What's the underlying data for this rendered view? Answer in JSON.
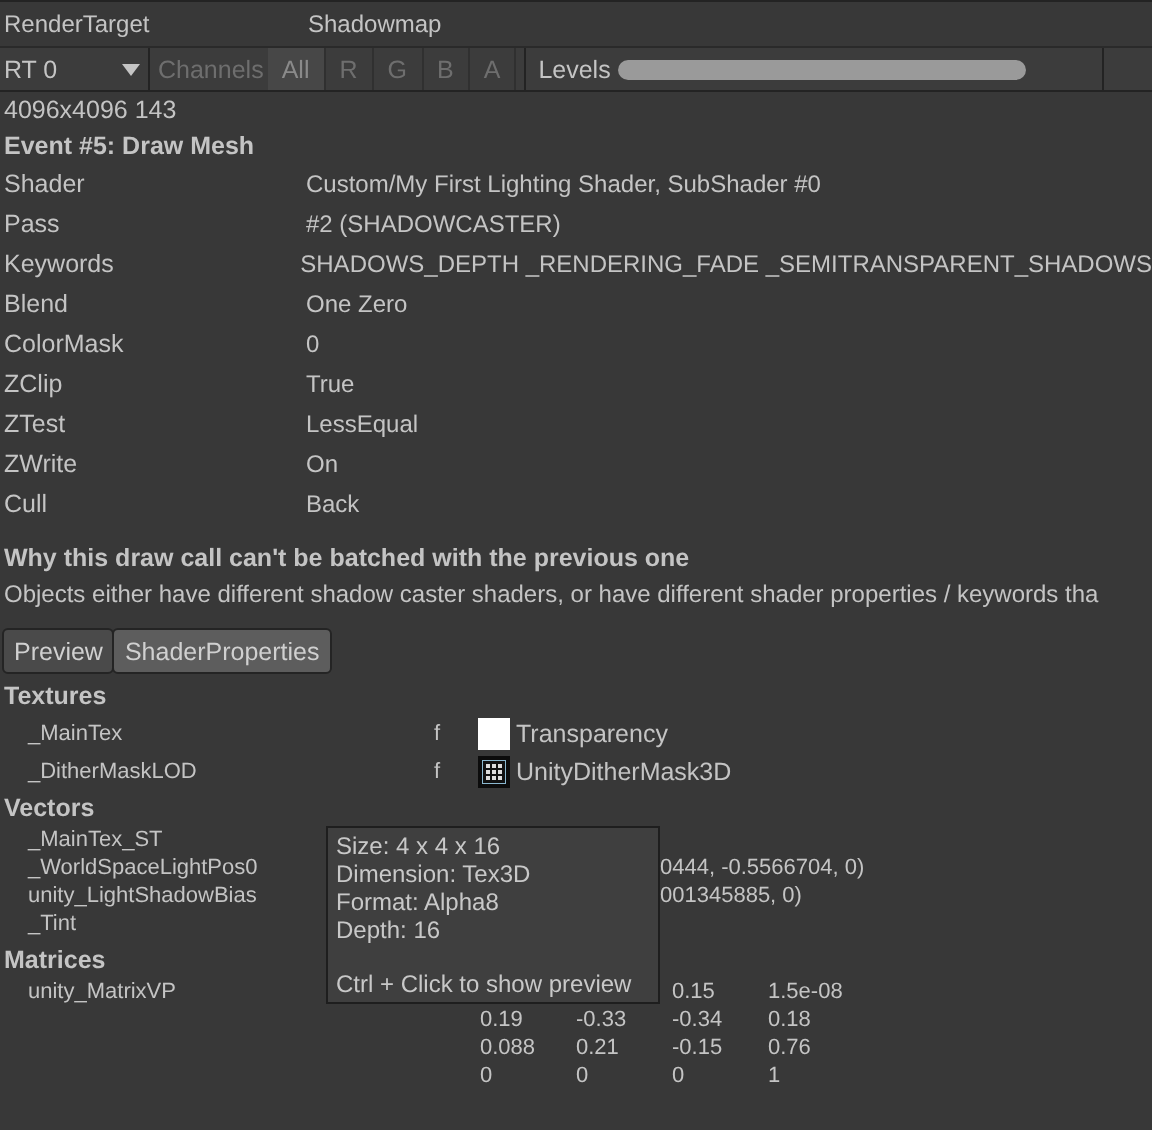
{
  "render_target": {
    "label": "RenderTarget",
    "value": "Shadowmap"
  },
  "toolbar": {
    "rt": "RT 0",
    "channels": {
      "label": "Channels",
      "disabled": true,
      "options": [
        {
          "label": "All",
          "selected": true
        },
        {
          "label": "R",
          "selected": false
        },
        {
          "label": "G",
          "selected": false
        },
        {
          "label": "B",
          "selected": false
        },
        {
          "label": "A",
          "selected": false
        }
      ]
    },
    "levels": {
      "label": "Levels",
      "level": 1
    }
  },
  "resolution": "4096x4096 143",
  "event_title": "Event #5: Draw Mesh",
  "properties": [
    {
      "name": "Shader",
      "value": "Custom/My First Lighting Shader, SubShader #0"
    },
    {
      "name": "Pass",
      "value": "#2 (SHADOWCASTER)"
    },
    {
      "name": "Keywords",
      "value": "SHADOWS_DEPTH _RENDERING_FADE _SEMITRANSPARENT_SHADOWS"
    },
    {
      "name": "Blend",
      "value": "One Zero"
    },
    {
      "name": "ColorMask",
      "value": "0"
    },
    {
      "name": "ZClip",
      "value": "True"
    },
    {
      "name": "ZTest",
      "value": "LessEqual"
    },
    {
      "name": "ZWrite",
      "value": "On"
    },
    {
      "name": "Cull",
      "value": "Back"
    }
  ],
  "batching": {
    "title": "Why this draw call can't be batched with the previous one",
    "text": "Objects either have different shadow caster shaders, or have different shader properties / keywords tha"
  },
  "tabs": [
    {
      "label": "Preview",
      "selected": false
    },
    {
      "label": "ShaderProperties",
      "selected": true
    }
  ],
  "textures": {
    "title": "Textures",
    "rows": [
      {
        "name": "_MainTex",
        "flag": "f",
        "kind": "white",
        "value": "Transparency"
      },
      {
        "name": "_DitherMaskLOD",
        "flag": "f",
        "kind": "pattern",
        "value": "UnityDitherMask3D"
      }
    ]
  },
  "vectors": {
    "title": "Vectors",
    "rows": [
      {
        "name": "_MainTex_ST"
      },
      {
        "name": "_WorldSpaceLightPos0",
        "value": "0444, -0.5566704, 0)"
      },
      {
        "name": "unity_LightShadowBias",
        "value": "001345885, 0)"
      },
      {
        "name": "_Tint"
      }
    ]
  },
  "matrices": {
    "title": "Matrices",
    "rows": [
      {
        "name": "unity_MatrixVP",
        "cells": [
          null,
          null,
          "0.15",
          "1.5e-08"
        ]
      },
      {
        "cells": [
          "0.19",
          "-0.33",
          "-0.34",
          "0.18"
        ]
      },
      {
        "cells": [
          "0.088",
          "0.21",
          "-0.15",
          "0.76"
        ]
      },
      {
        "cells": [
          "0",
          "0",
          "0",
          "1"
        ]
      }
    ]
  },
  "tooltip": {
    "lines": [
      "Size: 4 x 4 x 16",
      "Dimension: Tex3D",
      "Format: Alpha8",
      "Depth: 16"
    ],
    "hint": "Ctrl + Click to show preview"
  }
}
